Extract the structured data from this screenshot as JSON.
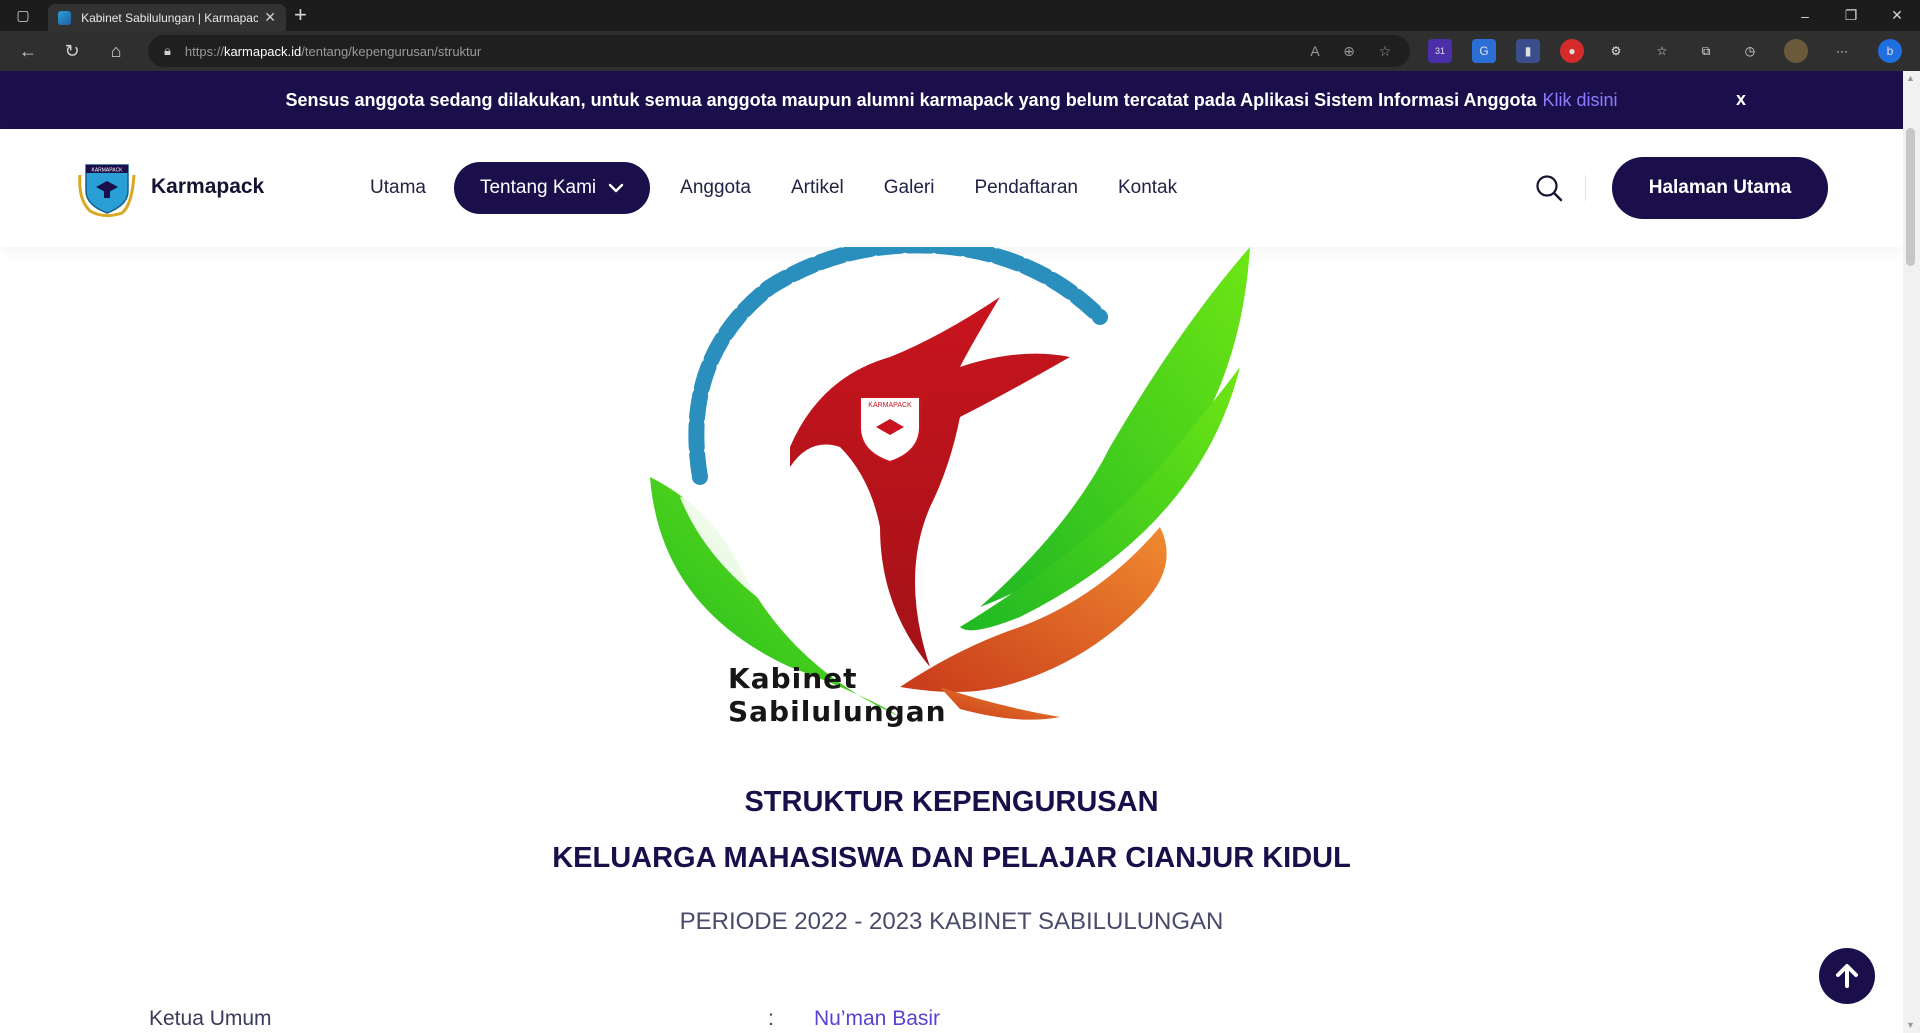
{
  "browser": {
    "tab_title": "Kabinet Sabilulungan | Karmapack",
    "url_domain": "karmapack.id",
    "url_prefix": "https://",
    "url_path": "/tentang/kepengurusan/struktur",
    "notification_badge": "31"
  },
  "announcement": {
    "message": "Sensus anggota sedang dilakukan, untuk semua anggota maupun alumni karmapack yang belum tercatat pada Aplikasi Sistem Informasi Anggota",
    "link_label": "Klik disini",
    "close_label": "x"
  },
  "header": {
    "brand": "Karmapack",
    "logo_text": "KARMAPACK",
    "nav": {
      "utama": "Utama",
      "tentang": "Tentang Kami",
      "anggota": "Anggota",
      "artikel": "Artikel",
      "galeri": "Galeri",
      "pendaftaran": "Pendaftaran",
      "kontak": "Kontak"
    },
    "cta_label": "Halaman Utama"
  },
  "hero": {
    "caption_line1": "Kabinet",
    "caption_line2": "Sabilulungan",
    "emblem_text": "KARMAPACK"
  },
  "content": {
    "title": "STRUKTUR KEPENGURUSAN",
    "subtitle": "KELUARGA MAHASISWA DAN PELAJAR CIANJUR KIDUL",
    "period": "PERIODE 2022 - 2023 KABINET SABILULUNGAN",
    "rows": [
      {
        "label": "Ketua Umum",
        "separator": ":",
        "value": "Nu’man Basir"
      }
    ]
  },
  "colors": {
    "primary": "#1a0f4a",
    "link": "#8b7bff",
    "value_text": "#5b3fd6",
    "logo_red": "#c8141e",
    "logo_green": "#3dd614",
    "logo_blue": "#2a8fbd",
    "logo_orange": "#e8602a"
  }
}
